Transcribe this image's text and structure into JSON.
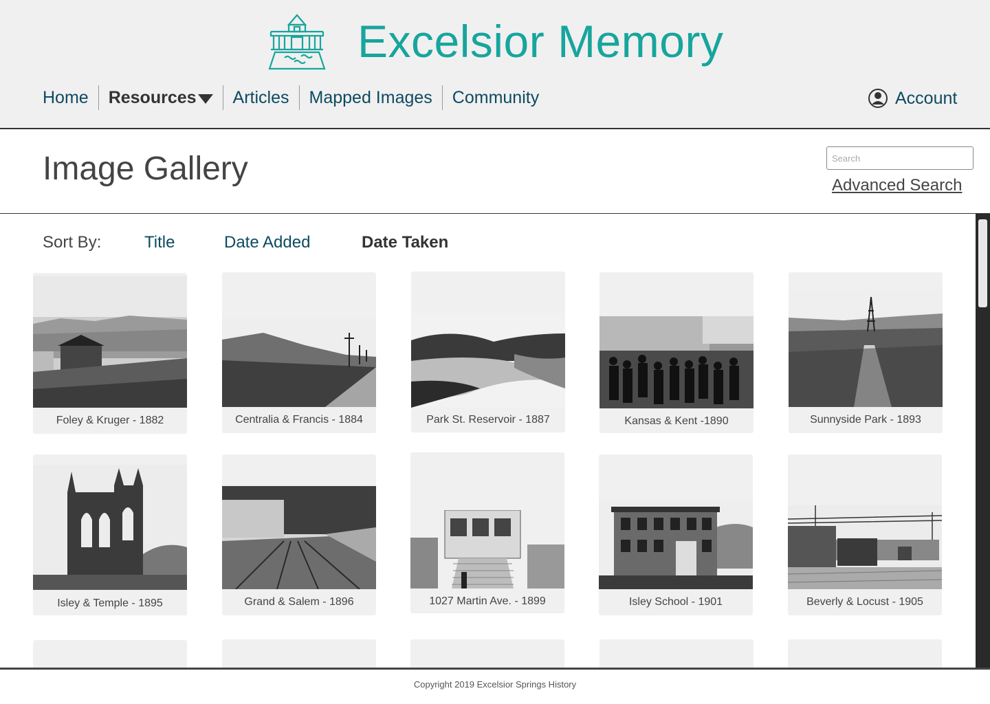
{
  "site": {
    "title": "Excelsior Memory",
    "logo_icon": "building-icon",
    "accent": "#17a59d",
    "nav_color": "#0e4a61"
  },
  "nav": {
    "items": [
      {
        "label": "Home"
      },
      {
        "label": "Resources",
        "dropdown": true,
        "active": true
      },
      {
        "label": "Articles"
      },
      {
        "label": "Mapped Images"
      },
      {
        "label": "Community"
      }
    ],
    "account_label": "Account",
    "account_icon": "user-circle-icon"
  },
  "page": {
    "title": "Image Gallery",
    "search_placeholder": "Search",
    "advanced_search": "Advanced Search"
  },
  "sort": {
    "label": "Sort By:",
    "options": [
      "Title",
      "Date Added",
      "Date Taken"
    ],
    "active": "Date Taken"
  },
  "gallery": [
    {
      "caption": "Foley & Kruger - 1882"
    },
    {
      "caption": "Centralia & Francis - 1884"
    },
    {
      "caption": "Park St. Reservoir  - 1887"
    },
    {
      "caption": "Kansas & Kent -1890"
    },
    {
      "caption": "Sunnyside Park - 1893"
    },
    {
      "caption": "Isley & Temple - 1895"
    },
    {
      "caption": "Grand & Salem - 1896"
    },
    {
      "caption": "1027 Martin Ave. - 1899"
    },
    {
      "caption": "Isley School - 1901"
    },
    {
      "caption": "Beverly & Locust - 1905"
    }
  ],
  "footer": {
    "copyright": "Copyright 2019 Excelsior Springs History"
  }
}
